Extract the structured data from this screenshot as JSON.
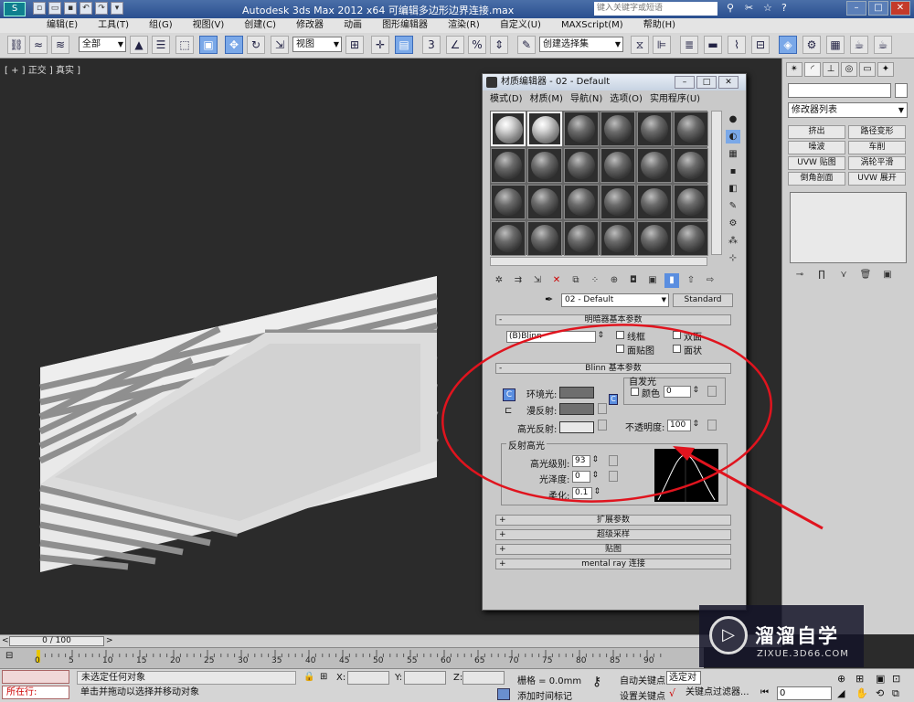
{
  "titlebar": {
    "logo": "S",
    "title": "Autodesk 3ds Max  2012 x64     可编辑多边形边界连接.max",
    "search_placeholder": "键入关键字或短语"
  },
  "menubar": [
    "编辑(E)",
    "工具(T)",
    "组(G)",
    "视图(V)",
    "创建(C)",
    "修改器",
    "动画",
    "图形编辑器",
    "渲染(R)",
    "自定义(U)",
    "MAXScript(M)",
    "帮助(H)"
  ],
  "toolbar": {
    "selection_filter": "全部",
    "ref_coord": "视图",
    "named_sel": "创建选择集"
  },
  "viewport": {
    "label": "[ + ] 正交 ] 真实 ]"
  },
  "command_panel": {
    "modifier_list": "修改器列表",
    "buttons": [
      "挤出",
      "路径变形",
      "噪波",
      "车削",
      "UVW 贴图",
      "涡轮平滑",
      "倒角剖面",
      "UVW 展开"
    ]
  },
  "material_editor": {
    "title": "材质编辑器 - 02 - Default",
    "menu": [
      "模式(D)",
      "材质(M)",
      "导航(N)",
      "选项(O)",
      "实用程序(U)"
    ],
    "material_name": "02 - Default",
    "material_type": "Standard",
    "shader_rollout": "明暗器基本参数",
    "shader_type": "(B)Blinn",
    "shader_options": [
      "线框",
      "双面",
      "面贴图",
      "面状"
    ],
    "blinn_rollout": "Blinn 基本参数",
    "self_illum": "自发光",
    "self_illum_color": "颜色",
    "self_illum_value": "0",
    "ambient": "环境光:",
    "diffuse": "漫反射:",
    "specular": "高光反射:",
    "opacity_label": "不透明度:",
    "opacity_value": "100",
    "spec_highlights": "反射高光",
    "spec_level_label": "高光级别:",
    "spec_level_value": "93",
    "glossiness_label": "光泽度:",
    "glossiness_value": "0",
    "soften_label": "柔化:",
    "soften_value": "0.1",
    "collapsed_rollouts": [
      "扩展参数",
      "超级采样",
      "贴图",
      "mental ray 连接"
    ]
  },
  "timeline": {
    "frame_display": "0 / 100",
    "ticks": [
      "0",
      "5",
      "10",
      "15",
      "20",
      "25",
      "30",
      "35",
      "40",
      "45",
      "50",
      "55",
      "60",
      "65",
      "70",
      "75",
      "80",
      "85",
      "90"
    ]
  },
  "statusbar": {
    "locator": "所在行:",
    "status1": "未选定任何对象",
    "status2": "单击并拖动以选择并移动对象",
    "x_label": "X:",
    "y_label": "Y:",
    "z_label": "Z:",
    "grid": "栅格 = 0.0mm",
    "add_time_tag": "添加时间标记",
    "auto_key": "自动关键点",
    "set_key": "设置关键点",
    "key_select": "选定对象",
    "key_filters": "关键点过滤器...",
    "frame": "0"
  },
  "watermark": {
    "title": "溜溜自学",
    "subtitle": "ZIXUE.3D66.COM"
  },
  "colors": {
    "annotation_red": "#e0141e",
    "selected_blue": "#7aa8e8"
  }
}
